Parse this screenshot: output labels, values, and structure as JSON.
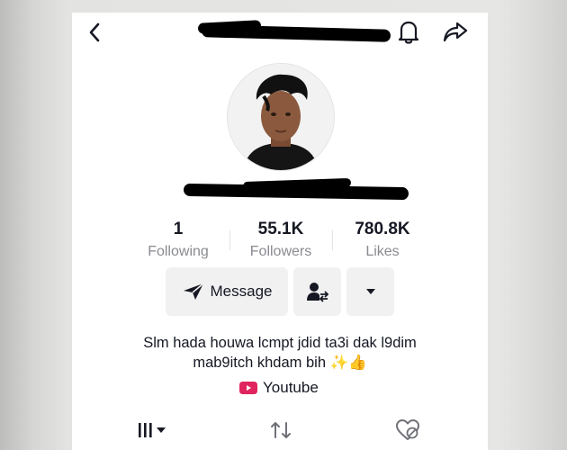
{
  "header": {
    "back_icon": "chevron-left-icon",
    "username_visible": "",
    "bell_icon": "bell-icon",
    "share_icon": "share-arrow-icon"
  },
  "profile": {
    "handle_visible": ""
  },
  "stats": [
    {
      "value": "1",
      "label": "Following"
    },
    {
      "value": "55.1K",
      "label": "Followers"
    },
    {
      "value": "780.8K",
      "label": "Likes"
    }
  ],
  "actions": {
    "message_label": "Message",
    "message_icon": "paper-plane-icon",
    "friend_icon": "user-swap-icon",
    "more_icon": "caret-down-icon"
  },
  "bio": {
    "line1": "Slm hada houwa lcmpt jdid ta3i dak l9dim",
    "line2": "mab9itch khdam bih ✨👍"
  },
  "link": {
    "icon": "youtube-icon",
    "label": "Youtube",
    "icon_color": "#e0245e"
  },
  "tabs": [
    {
      "icon": "grid-icon"
    },
    {
      "icon": "repost-icon"
    },
    {
      "icon": "liked-heart-icon"
    }
  ]
}
